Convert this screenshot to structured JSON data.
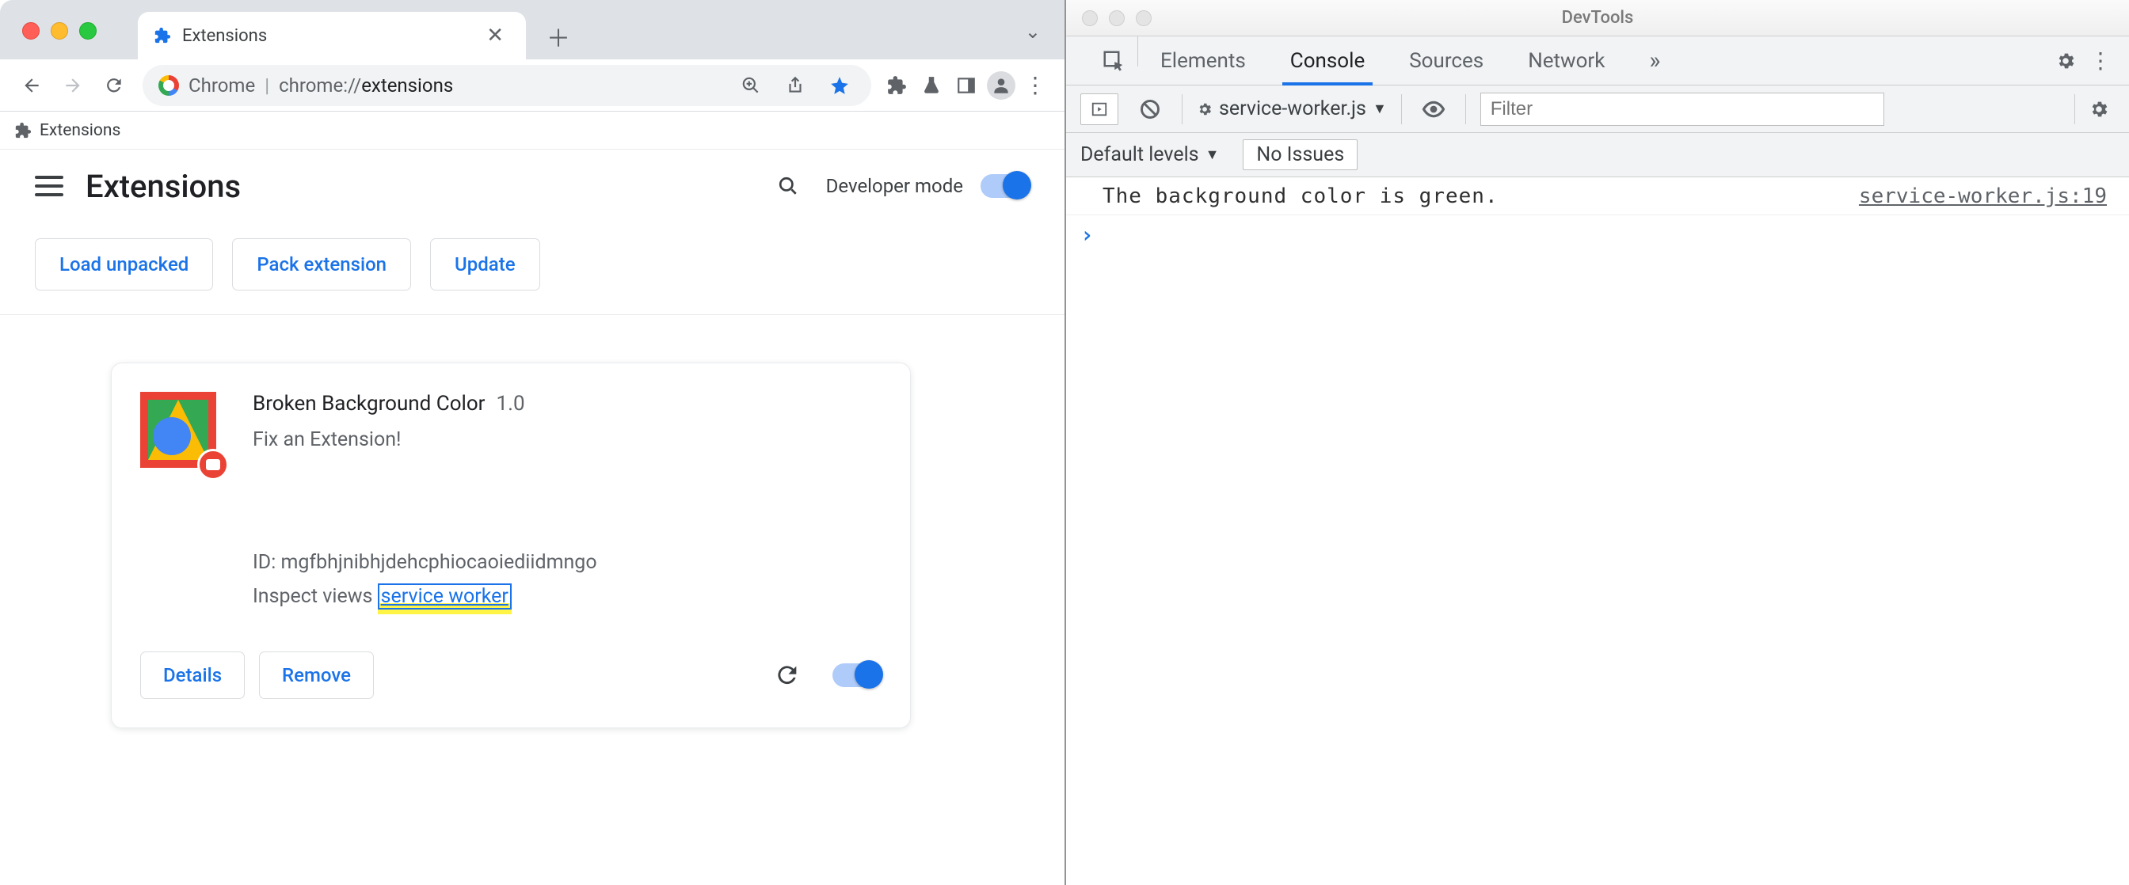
{
  "browser": {
    "tab": {
      "title": "Extensions"
    },
    "address": {
      "scheme_label": "Chrome",
      "path_prefix": "chrome://",
      "path_bold": "extensions"
    },
    "bookmark_bar": {
      "item1": "Extensions"
    },
    "page": {
      "title": "Extensions",
      "dev_mode_label": "Developer mode",
      "buttons": {
        "load_unpacked": "Load unpacked",
        "pack_extension": "Pack extension",
        "update": "Update"
      }
    },
    "card": {
      "name": "Broken Background Color",
      "version": "1.0",
      "description": "Fix an Extension!",
      "id_label": "ID: mgfbhjnibhjdehcphiocaoiediidmngo",
      "inspect_label": "Inspect views ",
      "inspect_link": "service worker",
      "details": "Details",
      "remove": "Remove"
    }
  },
  "devtools": {
    "title": "DevTools",
    "tabs": {
      "elements": "Elements",
      "console": "Console",
      "sources": "Sources",
      "network": "Network"
    },
    "context": "service-worker.js",
    "filter_placeholder": "Filter",
    "levels": "Default levels",
    "issues": "No Issues",
    "log": {
      "message": "The background color is green.",
      "source": "service-worker.js:19"
    }
  }
}
